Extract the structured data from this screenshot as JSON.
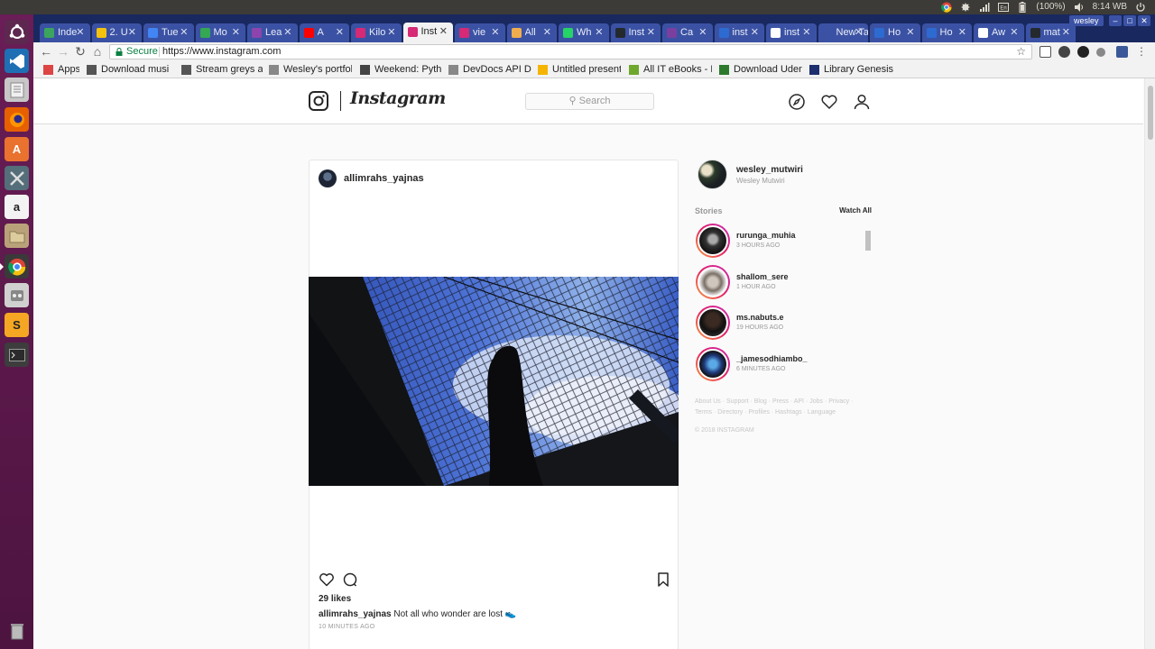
{
  "system_panel": {
    "battery": "(100%)",
    "clock": "8:14 WB"
  },
  "launcher": {
    "items": [
      {
        "name": "ubuntu-dash"
      },
      {
        "name": "vscode"
      },
      {
        "name": "files"
      },
      {
        "name": "firefox"
      },
      {
        "name": "software-center"
      },
      {
        "name": "system-tools"
      },
      {
        "name": "amazon"
      },
      {
        "name": "file-manager"
      },
      {
        "name": "chrome"
      },
      {
        "name": "media"
      },
      {
        "name": "sublime"
      },
      {
        "name": "terminal"
      },
      {
        "name": "trash"
      }
    ]
  },
  "browser": {
    "profile_user": "wesley",
    "tabs": [
      {
        "label": "Inde",
        "color": "#3ba55d"
      },
      {
        "label": "2. U",
        "color": "#f4c20d"
      },
      {
        "label": "Tue",
        "color": "#4285f4"
      },
      {
        "label": "Mo",
        "color": "#34a853"
      },
      {
        "label": "Lea",
        "color": "#8e44ad"
      },
      {
        "label": "A",
        "color": "#ff0000"
      },
      {
        "label": "Kilo",
        "color": "#d62976"
      },
      {
        "label": "Inst",
        "color": "#d62976"
      },
      {
        "label": "vie",
        "color": "#d62976"
      },
      {
        "label": "All",
        "color": "#f0ad4e"
      },
      {
        "label": "Wh",
        "color": "#25d366"
      },
      {
        "label": "Inst",
        "color": "#24292e"
      },
      {
        "label": "Ca",
        "color": "#7b3fa0"
      },
      {
        "label": "inst",
        "color": "#2d6bd1"
      },
      {
        "label": "inst",
        "color": "#ffffff"
      },
      {
        "label": "New Ta",
        "color": "#3b52a4"
      },
      {
        "label": "Ho",
        "color": "#2d6bd1"
      },
      {
        "label": "Ho",
        "color": "#2d6bd1"
      },
      {
        "label": "Aw",
        "color": "#ffffff"
      },
      {
        "label": "mat",
        "color": "#24292e"
      }
    ],
    "active_tab_index": 7,
    "secure_label": "Secure",
    "url": "https://www.instagram.com",
    "bookmarks": [
      {
        "label": "Apps"
      },
      {
        "label": "Download musi"
      },
      {
        "label": "Stream greys ar"
      },
      {
        "label": "Wesley's portfol"
      },
      {
        "label": "Weekend: Pytho"
      },
      {
        "label": "DevDocs API Do"
      },
      {
        "label": "Untitled present"
      },
      {
        "label": "All IT eBooks - Fr"
      },
      {
        "label": "Download Uden"
      },
      {
        "label": "Library Genesis"
      }
    ]
  },
  "instagram": {
    "wordmark": "Instagram",
    "search_placeholder": "Search",
    "post": {
      "username": "allimrahs_yajnas",
      "likes": "29 likes",
      "caption_user": "allimrahs_yajnas",
      "caption_text": "Not all who wonder are lost 👟",
      "time": "10 MINUTES AGO"
    },
    "me": {
      "username": "wesley_mutwiri",
      "full_name": "Wesley Mutwiri"
    },
    "stories": {
      "title": "Stories",
      "watch_all": "Watch All",
      "items": [
        {
          "username": "rurunga_muhia",
          "time": "3 HOURS AGO"
        },
        {
          "username": "shallom_sere",
          "time": "1 HOUR AGO"
        },
        {
          "username": "ms.nabuts.e",
          "time": "19 HOURS AGO"
        },
        {
          "username": "_jamesodhiambo_",
          "time": "6 MINUTES AGO"
        }
      ]
    },
    "footer_links": "About Us · Support · Blog · Press · API · Jobs · Privacy · Terms · Directory · Profiles · Hashtags · Language",
    "copyright": "© 2018 INSTAGRAM"
  }
}
